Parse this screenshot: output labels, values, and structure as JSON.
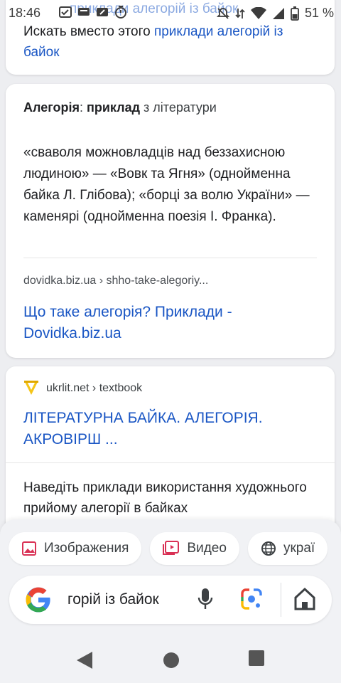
{
  "status_bar": {
    "time": "18:46",
    "battery": "51 %",
    "ghost_text": "приклади алегорій із байок"
  },
  "results": {
    "card1": {
      "text_prefix": "Искать вместо этого ",
      "link": "приклади алегорій із байок"
    },
    "card2": {
      "head_term1": "Алегорія",
      "head_colon": ": ",
      "head_term2": "приклад",
      "head_rest": " з літератури",
      "quote": " «сваволя можновладців над беззахисною людиною» — «Вовк та Ягня» (однойменна байка Л. Глібова); «борці за волю України» — каменярі (однойменна поезія І. Франка).",
      "url": "dovidka.biz.ua › shho-take-alegoriy...",
      "title": "Що таке алегорія? Приклади - Dovidka.biz.ua"
    },
    "card3": {
      "url": "ukrlit.net › textbook",
      "title": "ЛІТЕРАТУРНА БАЙКА. АЛЕГОРІЯ. АКРОВІРШ ...",
      "description": "Наведіть приклади використання художнього прийому алегорії в байках"
    }
  },
  "chips": [
    {
      "label": "Изображения",
      "icon": "image-icon"
    },
    {
      "label": "Видео",
      "icon": "video-icon"
    },
    {
      "label": "украї",
      "icon": "globe-icon"
    }
  ],
  "search": {
    "query": "приклади алегорій із байок",
    "visible_query": "горій із байок"
  },
  "colors": {
    "link": "#1a56c4",
    "google_blue": "#4285f4",
    "google_red": "#ea4335",
    "google_yellow": "#fbbc05",
    "google_green": "#34a853",
    "favicon_yellow": "#f5c518"
  }
}
